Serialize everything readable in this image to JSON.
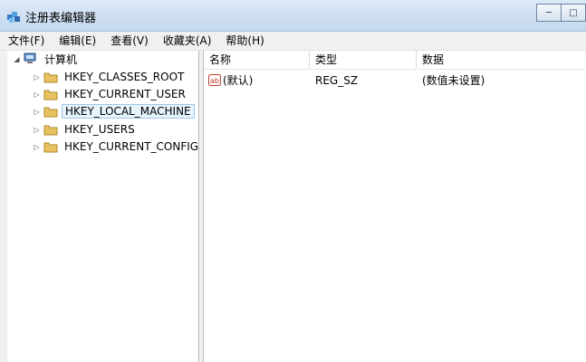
{
  "window": {
    "title": "注册表编辑器",
    "min_glyph": "─",
    "max_glyph": "□"
  },
  "menu": [
    "文件(F)",
    "编辑(E)",
    "查看(V)",
    "收藏夹(A)",
    "帮助(H)"
  ],
  "tree": {
    "root": "计算机",
    "nodes": [
      {
        "label": "HKEY_CLASSES_ROOT",
        "selected": false
      },
      {
        "label": "HKEY_CURRENT_USER",
        "selected": false
      },
      {
        "label": "HKEY_LOCAL_MACHINE",
        "selected": true
      },
      {
        "label": "HKEY_USERS",
        "selected": false
      },
      {
        "label": "HKEY_CURRENT_CONFIG",
        "selected": false
      }
    ]
  },
  "values_table": {
    "columns": [
      "名称",
      "类型",
      "数据"
    ],
    "rows": [
      {
        "name": "(默认)",
        "type": "REG_SZ",
        "data": "(数值未设置)"
      }
    ]
  }
}
